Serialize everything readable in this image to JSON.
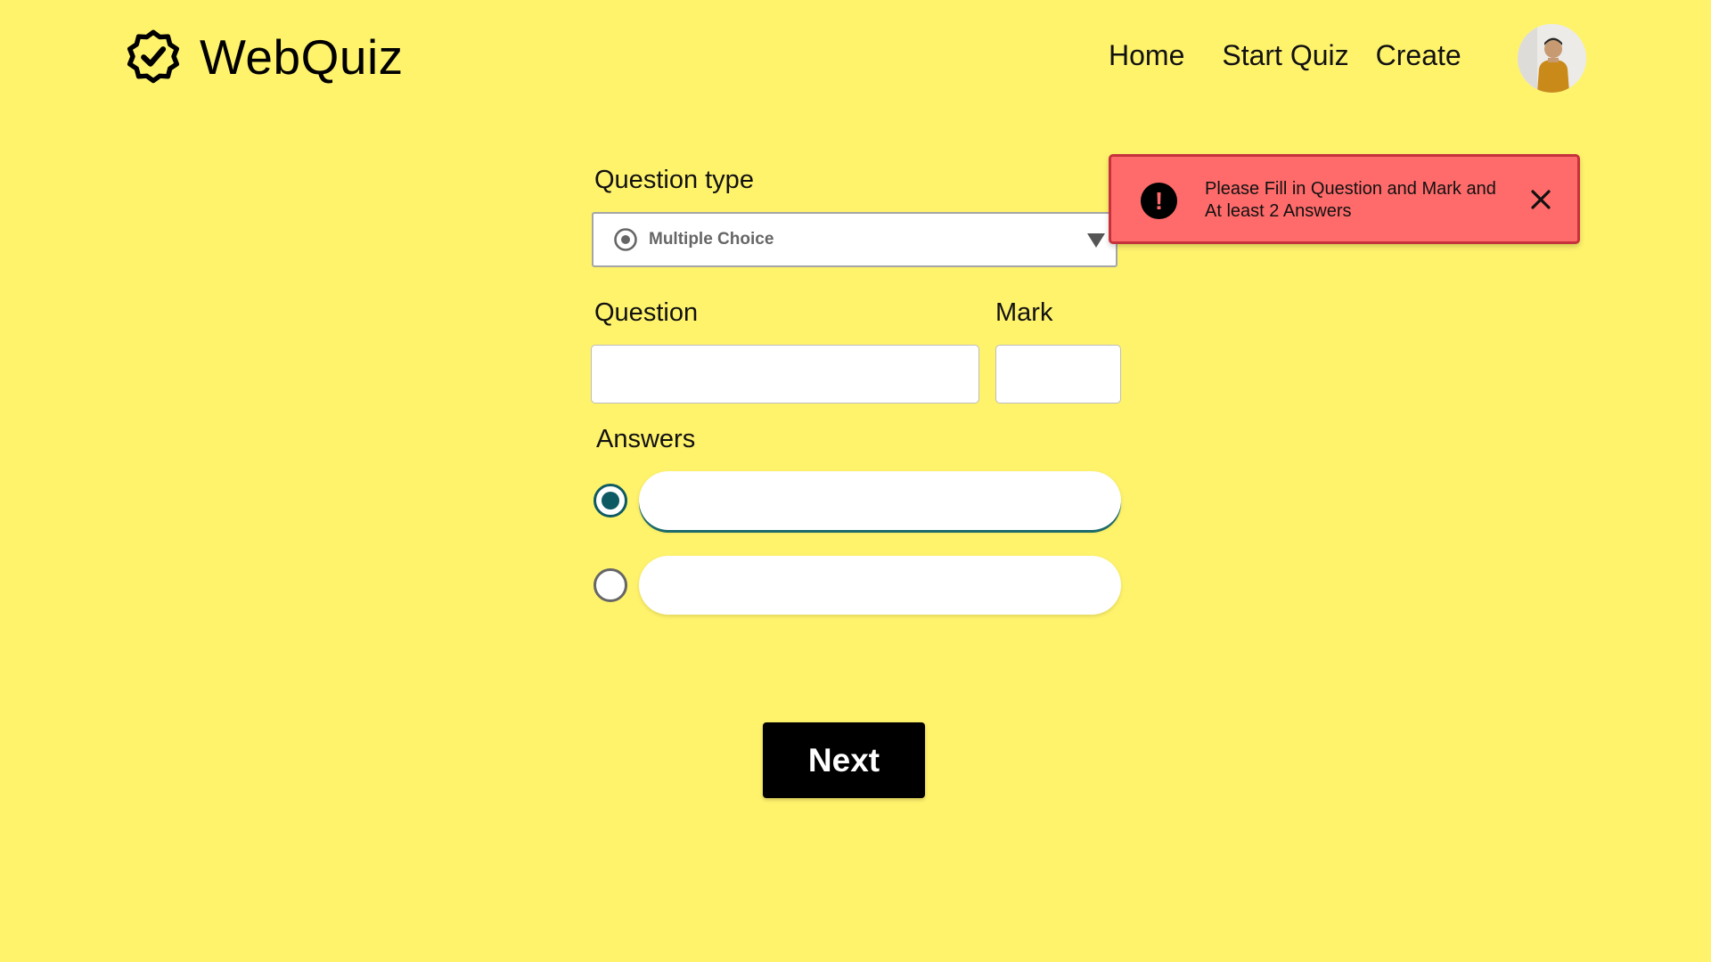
{
  "app": {
    "name": "WebQuiz",
    "logo_icon": "verified-gear-check-icon"
  },
  "nav": {
    "links": [
      {
        "label": "Home"
      },
      {
        "label": "Start Quiz"
      },
      {
        "label": "Create"
      }
    ],
    "avatar_icon": "user-avatar"
  },
  "form": {
    "question_type": {
      "label": "Question type",
      "selected": "Multiple Choice",
      "selected_icon": "radio-button-icon"
    },
    "question": {
      "label": "Question",
      "value": "",
      "placeholder": ""
    },
    "mark": {
      "label": "Mark",
      "value": "",
      "placeholder": ""
    },
    "answers": {
      "label": "Answers",
      "items": [
        {
          "value": "",
          "placeholder": "",
          "checked": true
        },
        {
          "value": "",
          "placeholder": "",
          "checked": false
        }
      ]
    },
    "next_label": "Next"
  },
  "toast": {
    "message": "Please Fill in Question and Mark and At least 2 Answers",
    "icon": "!",
    "close_icon": "close-icon"
  },
  "colors": {
    "background": "#FFF36C",
    "toast_background": "#FF6B6B",
    "toast_border": "#C5323B",
    "radio_checked": "#0E5A63",
    "button": "#000000"
  }
}
